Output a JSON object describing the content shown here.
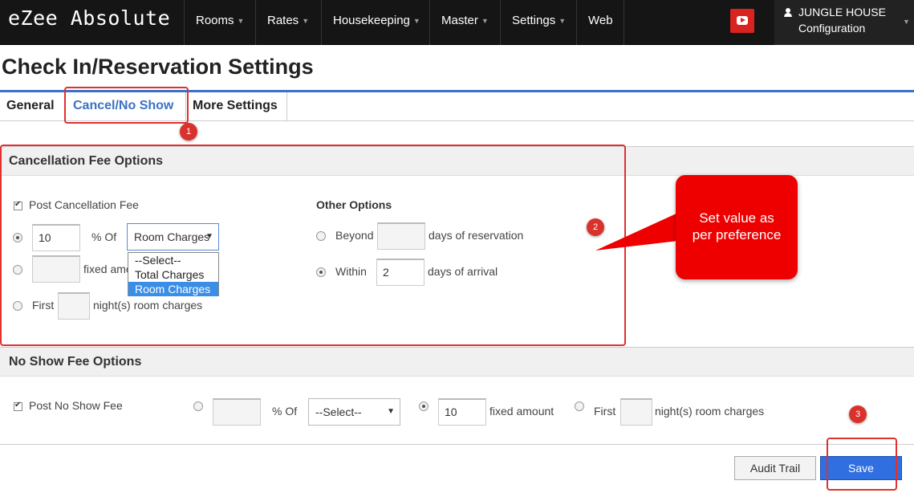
{
  "header": {
    "brand": "eZee Absolute",
    "nav": [
      {
        "label": "Rooms",
        "has_caret": true
      },
      {
        "label": "Rates",
        "has_caret": true
      },
      {
        "label": "Housekeeping",
        "has_caret": true
      },
      {
        "label": "Master",
        "has_caret": true
      },
      {
        "label": "Settings",
        "has_caret": true
      },
      {
        "label": "Web",
        "has_caret": false
      }
    ],
    "youtube_icon": "youtube-icon",
    "property_name": "JUNGLE HOUSE",
    "property_sub": "Configuration",
    "user_icon": "user-icon"
  },
  "page": {
    "title": "Check In/Reservation Settings",
    "tabs": [
      {
        "label": "General",
        "active": false
      },
      {
        "label": "Cancel/No Show",
        "active": true
      },
      {
        "label": "More Settings",
        "active": false
      }
    ]
  },
  "cancellation": {
    "heading": "Cancellation Fee Options",
    "post_fee_label": "Post Cancellation Fee",
    "post_fee_checked": true,
    "percent_value": "10",
    "percent_of_label": "% Of",
    "percent_of_selected": "Room Charges",
    "percent_of_options": [
      "--Select--",
      "Total Charges",
      "Room Charges"
    ],
    "fixed_amount_label": "fixed amount",
    "first_label": "First",
    "nights_label": "night(s) room charges",
    "selected_option": "percent",
    "other_heading": "Other Options",
    "beyond_label": "Beyond",
    "beyond_suffix": "days of reservation",
    "within_label": "Within",
    "within_value": "2",
    "within_suffix": "days of arrival",
    "selected_other": "within"
  },
  "noshow": {
    "heading": "No Show Fee Options",
    "post_fee_label": "Post No Show Fee",
    "post_fee_checked": true,
    "percent_of_label": "% Of",
    "percent_of_selected": "--Select--",
    "fixed_value": "10",
    "fixed_amount_label": "fixed amount",
    "first_label": "First",
    "nights_label": "night(s) room charges",
    "selected_option": "fixed"
  },
  "annotations": {
    "badge_1": "1",
    "badge_2": "2",
    "badge_3": "3",
    "callout_line1": "Set value as",
    "callout_line2": "per preference",
    "highlight_color": "#e03030"
  },
  "footer": {
    "audit_label": "Audit Trail",
    "save_label": "Save"
  },
  "colors": {
    "accent": "#3a72c6",
    "save_button": "#2f6fe0",
    "topbar": "#151515",
    "callout": "#ee0000"
  }
}
